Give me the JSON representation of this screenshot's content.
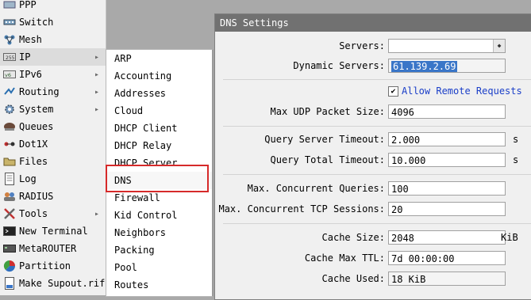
{
  "left_menu": {
    "items": [
      {
        "label": "PPP",
        "icon": "ppp-icon"
      },
      {
        "label": "Switch",
        "icon": "switch-icon"
      },
      {
        "label": "Mesh",
        "icon": "mesh-icon"
      },
      {
        "label": "IP",
        "icon": "ip-icon",
        "arrow": true
      },
      {
        "label": "IPv6",
        "icon": "ipv6-icon",
        "arrow": true
      },
      {
        "label": "Routing",
        "icon": "routing-icon",
        "arrow": true
      },
      {
        "label": "System",
        "icon": "system-icon",
        "arrow": true
      },
      {
        "label": "Queues",
        "icon": "queues-icon"
      },
      {
        "label": "Dot1X",
        "icon": "dot1x-icon"
      },
      {
        "label": "Files",
        "icon": "files-icon"
      },
      {
        "label": "Log",
        "icon": "log-icon"
      },
      {
        "label": "RADIUS",
        "icon": "radius-icon"
      },
      {
        "label": "Tools",
        "icon": "tools-icon",
        "arrow": true
      },
      {
        "label": "New Terminal",
        "icon": "terminal-icon"
      },
      {
        "label": "MetaROUTER",
        "icon": "metarouter-icon"
      },
      {
        "label": "Partition",
        "icon": "partition-icon"
      },
      {
        "label": "Make Supout.rif",
        "icon": "supout-icon"
      }
    ]
  },
  "submenu": {
    "items": [
      "ARP",
      "Accounting",
      "Addresses",
      "Cloud",
      "DHCP Client",
      "DHCP Relay",
      "DHCP Server",
      "DNS",
      "Firewall",
      "Kid Control",
      "Neighbors",
      "Packing",
      "Pool",
      "Routes"
    ]
  },
  "dns_settings": {
    "title": "DNS Settings",
    "servers_label": "Servers:",
    "servers_value": "",
    "dynamic_servers_label": "Dynamic Servers:",
    "dynamic_servers_value": "61.139.2.69",
    "allow_remote_label": "Allow Remote Requests",
    "allow_remote_checked": true,
    "max_udp_label": "Max UDP Packet Size:",
    "max_udp_value": "4096",
    "query_server_timeout_label": "Query Server Timeout:",
    "query_server_timeout_value": "2.000",
    "query_server_timeout_unit": "s",
    "query_total_timeout_label": "Query Total Timeout:",
    "query_total_timeout_value": "10.000",
    "query_total_timeout_unit": "s",
    "max_concurrent_queries_label": "Max. Concurrent Queries:",
    "max_concurrent_queries_value": "100",
    "max_concurrent_tcp_label": "Max. Concurrent TCP Sessions:",
    "max_concurrent_tcp_value": "20",
    "cache_size_label": "Cache Size:",
    "cache_size_value": "2048",
    "cache_size_unit": "KiB",
    "cache_max_ttl_label": "Cache Max TTL:",
    "cache_max_ttl_value": "7d 00:00:00",
    "cache_used_label": "Cache Used:",
    "cache_used_value": "18 KiB"
  },
  "colors": {
    "highlight_border": "#d62a2a",
    "window_title_bg": "#717171",
    "selection_bg": "#3a76c8",
    "allow_remote_text": "#1a3ec8"
  }
}
